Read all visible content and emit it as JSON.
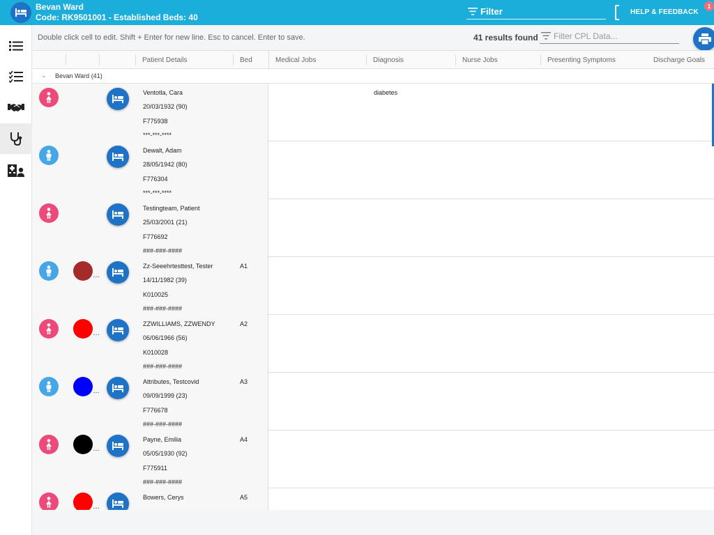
{
  "header": {
    "ward_name": "Bevan Ward",
    "ward_code": "Code: RK9501001 - Established Beds: 40",
    "filter_label": "Filter",
    "help_label": "HELP & FEEDBACK",
    "notification_count": "1"
  },
  "nav": {
    "items": [
      {
        "name": "list-icon"
      },
      {
        "name": "checklist-icon"
      },
      {
        "name": "handshake-icon"
      },
      {
        "name": "stethoscope-icon"
      },
      {
        "name": "hospital-user-icon"
      }
    ]
  },
  "toolbar": {
    "hint": "Double click cell to edit. Shift + Enter for new line. Esc to cancel. Enter to save.",
    "results": "41 results found",
    "filter_placeholder": "Filter CPL Data..."
  },
  "grid": {
    "columns": [
      "Patient Details",
      "Bed",
      "Medical Jobs",
      "Diagnosis",
      "Nurse Jobs",
      "Presenting Symptoms",
      "Discharge Goals"
    ],
    "group_label": "Bevan Ward (41)",
    "patients": [
      {
        "gender": "female",
        "flag_color": null,
        "name": "Ventotla, Cara",
        "dob": "20/03/1932 (90)",
        "id": "F775938",
        "nhs": "***-***-****",
        "bed": "",
        "diagnosis": "diabetes"
      },
      {
        "gender": "male",
        "flag_color": null,
        "name": "Dewalt, Adam",
        "dob": "28/05/1942 (80)",
        "id": "F776304",
        "nhs": "***-***-****",
        "bed": "",
        "diagnosis": ""
      },
      {
        "gender": "female",
        "flag_color": null,
        "name": "Testingteam, Patient",
        "dob": "25/03/2001 (21)",
        "id": "F776692",
        "nhs": "###-###-####",
        "bed": "",
        "diagnosis": ""
      },
      {
        "gender": "male",
        "flag_color": "#a52a2a",
        "name": "Zz-Seeehrtesttest, Tester",
        "dob": "14/11/1982 (39)",
        "id": "K010025",
        "nhs": "###-###-####",
        "bed": "A1",
        "diagnosis": ""
      },
      {
        "gender": "female",
        "flag_color": "#ff0000",
        "name": "ZZWILLIAMS, ZZWENDY",
        "dob": "06/06/1966 (56)",
        "id": "K010028",
        "nhs": "###-###-####",
        "bed": "A2",
        "diagnosis": ""
      },
      {
        "gender": "male",
        "flag_color": "#0000ff",
        "name": "Attributes, Testcovid",
        "dob": "09/09/1999 (23)",
        "id": "F776678",
        "nhs": "###-###-####",
        "bed": "A3",
        "diagnosis": ""
      },
      {
        "gender": "female",
        "flag_color": "#000000",
        "name": "Payne, Emilia",
        "dob": "05/05/1930 (92)",
        "id": "F775911",
        "nhs": "###-###-####",
        "bed": "A4",
        "diagnosis": ""
      },
      {
        "gender": "female",
        "flag_color": "#ff0000",
        "name": "Bowers, Cerys",
        "dob": "",
        "id": "",
        "nhs": "",
        "bed": "A5",
        "diagnosis": ""
      }
    ]
  },
  "colors": {
    "topbar": "#1baedb",
    "accent_blue": "#1f73c6",
    "female": "#ec4a7a",
    "male": "#46a7e8"
  }
}
